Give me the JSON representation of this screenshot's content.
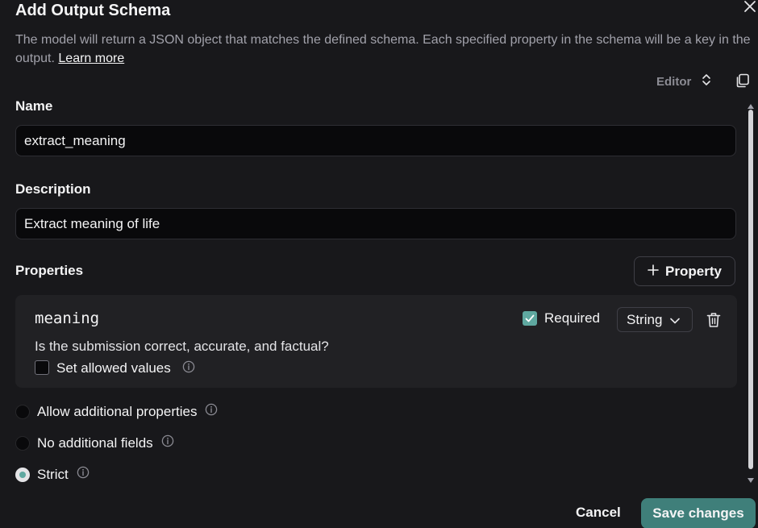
{
  "dialog": {
    "title": "Add Output Schema",
    "description": "The model will return a JSON object that matches the defined schema. Each specified property in the schema will be a key in the output.",
    "learn_more": "Learn more"
  },
  "toolbar": {
    "mode_label": "Editor"
  },
  "form": {
    "name_label": "Name",
    "name_value": "extract_meaning",
    "description_label": "Description",
    "description_value": "Extract meaning of life",
    "properties_label": "Properties",
    "add_property_label": "Property"
  },
  "property": {
    "name": "meaning",
    "required_label": "Required",
    "required_checked": true,
    "type_value": "String",
    "description": "Is the submission correct, accurate, and factual?",
    "allowed_values_label": "Set allowed values",
    "allowed_values_checked": false
  },
  "options": [
    {
      "label": "Allow additional properties",
      "selected": false
    },
    {
      "label": "No additional fields",
      "selected": false
    },
    {
      "label": "Strict",
      "selected": true
    }
  ],
  "footer": {
    "cancel_label": "Cancel",
    "save_label": "Save changes"
  },
  "colors": {
    "background": "#18181b",
    "accent": "#5fa8a0",
    "save_button": "#3f7f7a"
  }
}
